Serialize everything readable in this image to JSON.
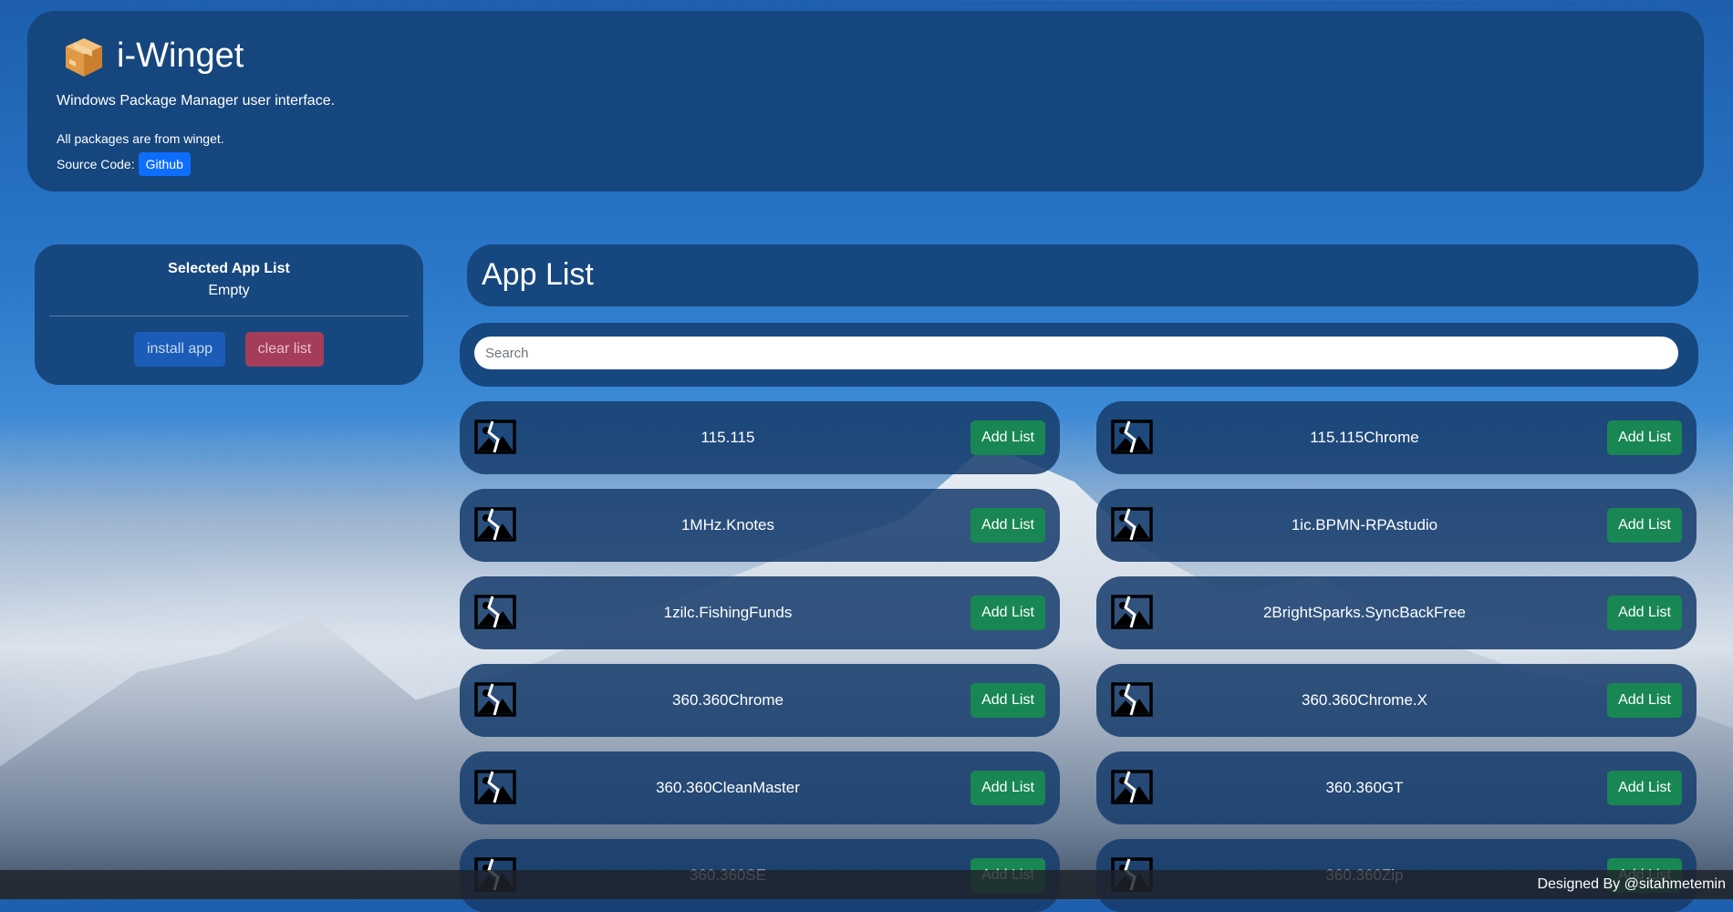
{
  "header": {
    "title": "i-Winget",
    "subtitle": "Windows Package Manager user interface.",
    "info_line": "All packages are from winget.",
    "source_label": "Source Code:",
    "github_label": "Github"
  },
  "selected_list": {
    "title": "Selected App List",
    "status": "Empty",
    "install_label": "install app",
    "clear_label": "clear list"
  },
  "app_list": {
    "title": "App List",
    "search_placeholder": "Search",
    "add_label": "Add List",
    "apps": [
      "115.115",
      "115.115Chrome",
      "1MHz.Knotes",
      "1ic.BPMN-RPAstudio",
      "1zilc.FishingFunds",
      "2BrightSparks.SyncBackFree",
      "360.360Chrome",
      "360.360Chrome.X",
      "360.360CleanMaster",
      "360.360GT",
      "360.360SE",
      "360.360Zip"
    ]
  },
  "footer": {
    "credit": "Designed By @sitahmetemin"
  },
  "colors": {
    "card_bg": "#17477f",
    "primary": "#0d6efd",
    "success": "#198754",
    "danger": "#a43d5a"
  }
}
